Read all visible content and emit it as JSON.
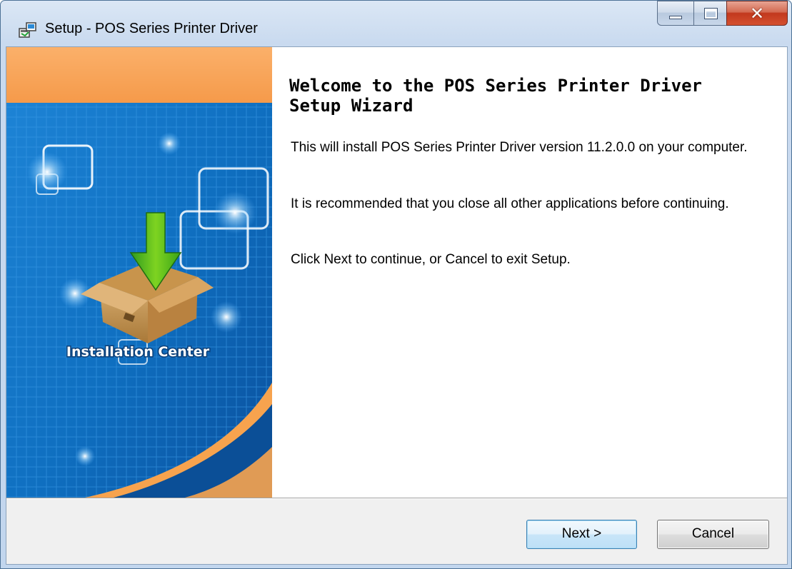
{
  "window": {
    "title": "Setup - POS Series Printer Driver",
    "controls": {
      "minimize": "minimize-icon",
      "maximize": "maximize-icon",
      "close": "close-icon"
    }
  },
  "banner": {
    "caption": "Installation Center",
    "image_icon": "box-download-icon"
  },
  "main": {
    "heading": "Welcome to the POS Series Printer Driver Setup Wizard",
    "paragraphs": [
      "This will install POS Series Printer Driver version 11.2.0.0 on your computer.",
      "It is recommended that you close all other applications before continuing.",
      "Click Next to continue, or Cancel to exit Setup."
    ]
  },
  "buttons": {
    "next_label": "Next >",
    "cancel_label": "Cancel"
  },
  "colors": {
    "title_bar": "#c9daef",
    "banner_orange": "#f9a65a",
    "banner_blue": "#1776c7",
    "close_button": "#c2381d",
    "next_button_border": "#3c7fb1"
  }
}
